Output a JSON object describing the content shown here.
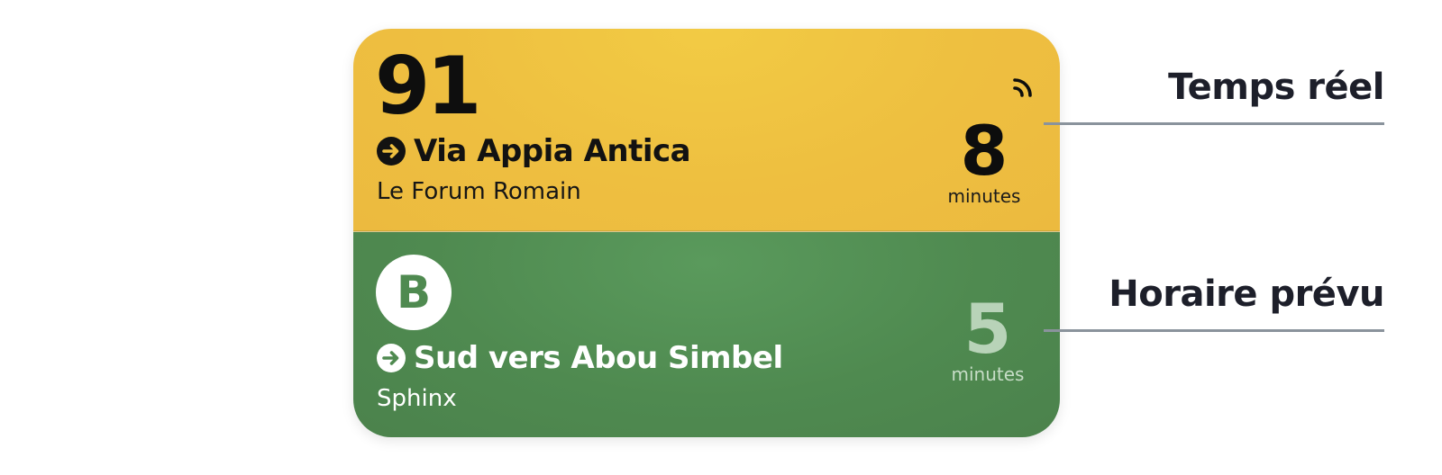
{
  "widget": {
    "rows": [
      {
        "route_label": "91",
        "direction": "Via Appia Antica",
        "stop": "Le Forum Romain",
        "time_value": "8",
        "time_unit": "minutes",
        "realtime": true,
        "background": "#eebf40",
        "text_color": "#121212"
      },
      {
        "route_label": "B",
        "direction": "Sud vers Abou Simbel",
        "stop": "Sphinx",
        "time_value": "5",
        "time_unit": "minutes",
        "realtime": false,
        "background": "#4f8a50",
        "text_color": "#ffffff"
      }
    ],
    "icons": {
      "direction": "arrow-right-circle-icon",
      "realtime": "realtime-signal-icon"
    }
  },
  "callouts": [
    {
      "label": "Temps réel"
    },
    {
      "label": "Horaire prévu"
    }
  ],
  "colors": {
    "callout_line": "#8a939c",
    "callout_text": "#1d1f2a"
  }
}
